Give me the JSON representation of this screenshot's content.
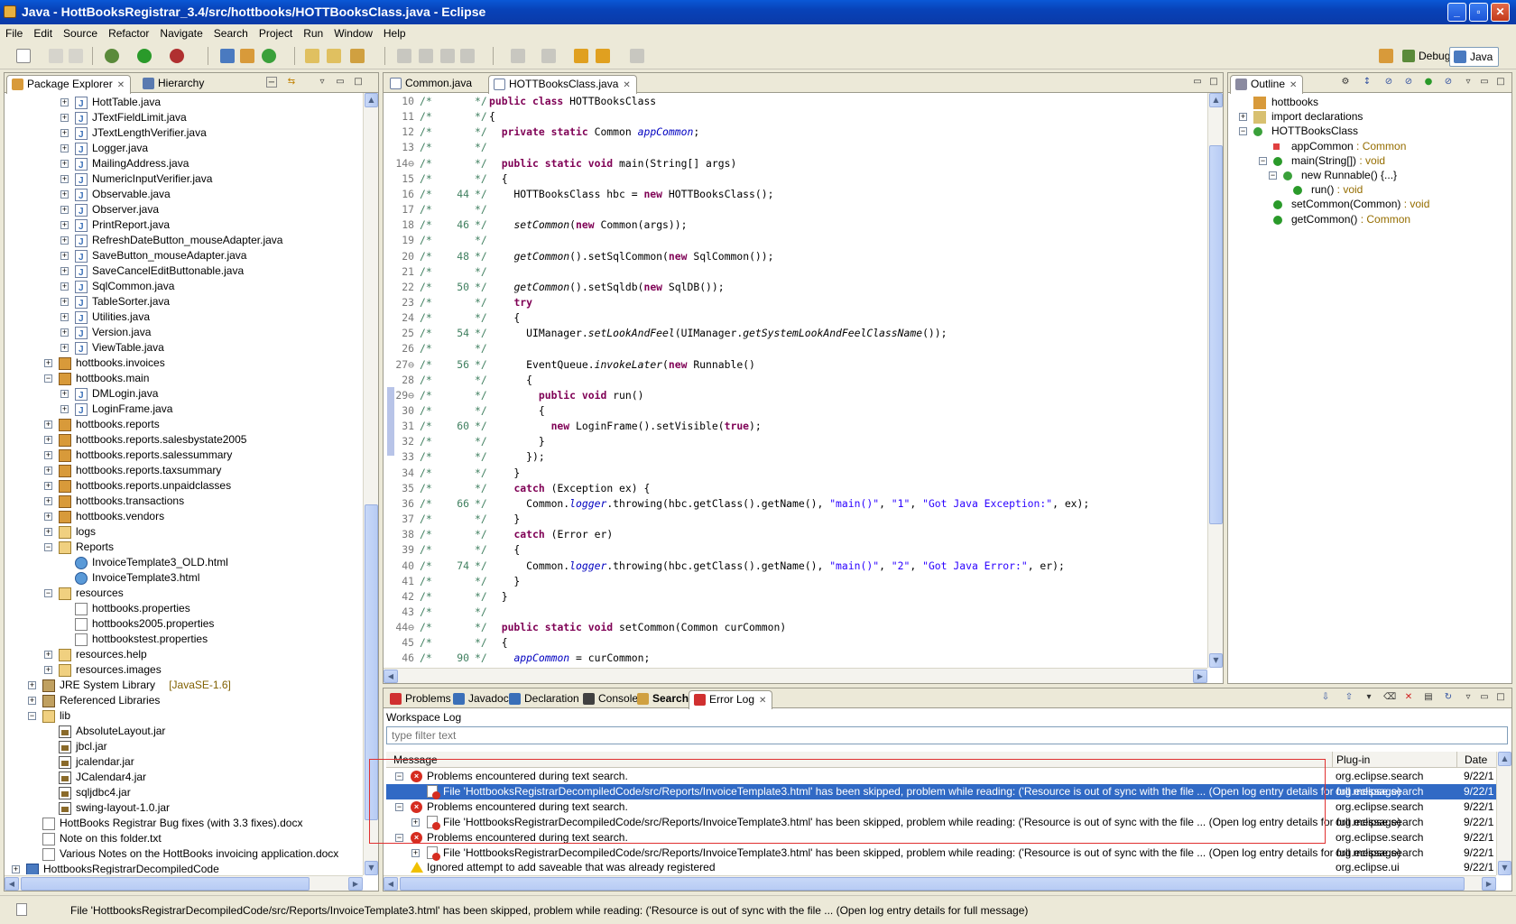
{
  "window": {
    "title": "Java - HottBooksRegistrar_3.4/src/hottbooks/HOTTBooksClass.java - Eclipse",
    "min": "_",
    "max": "▫",
    "close": "✕"
  },
  "menu": [
    "File",
    "Edit",
    "Source",
    "Refactor",
    "Navigate",
    "Search",
    "Project",
    "Run",
    "Window",
    "Help"
  ],
  "perspectives": {
    "debug": "Debug",
    "java": "Java"
  },
  "package_explorer": {
    "tabs": [
      "Package Explorer",
      "Hierarchy"
    ],
    "items": [
      {
        "label": "HottTable.java",
        "icon": "java",
        "indent": 3,
        "exp": "+"
      },
      {
        "label": "JTextFieldLimit.java",
        "icon": "java",
        "indent": 3,
        "exp": "+"
      },
      {
        "label": "JTextLengthVerifier.java",
        "icon": "java",
        "indent": 3,
        "exp": "+"
      },
      {
        "label": "Logger.java",
        "icon": "java",
        "indent": 3,
        "exp": "+"
      },
      {
        "label": "MailingAddress.java",
        "icon": "java",
        "indent": 3,
        "exp": "+"
      },
      {
        "label": "NumericInputVerifier.java",
        "icon": "java",
        "indent": 3,
        "exp": "+"
      },
      {
        "label": "Observable.java",
        "icon": "java",
        "indent": 3,
        "exp": "+"
      },
      {
        "label": "Observer.java",
        "icon": "java",
        "indent": 3,
        "exp": "+"
      },
      {
        "label": "PrintReport.java",
        "icon": "java",
        "indent": 3,
        "exp": "+"
      },
      {
        "label": "RefreshDateButton_mouseAdapter.java",
        "icon": "java",
        "indent": 3,
        "exp": "+"
      },
      {
        "label": "SaveButton_mouseAdapter.java",
        "icon": "java",
        "indent": 3,
        "exp": "+"
      },
      {
        "label": "SaveCancelEditButtonable.java",
        "icon": "java",
        "indent": 3,
        "exp": "+"
      },
      {
        "label": "SqlCommon.java",
        "icon": "java",
        "indent": 3,
        "exp": "+"
      },
      {
        "label": "TableSorter.java",
        "icon": "java",
        "indent": 3,
        "exp": "+"
      },
      {
        "label": "Utilities.java",
        "icon": "java",
        "indent": 3,
        "exp": "+"
      },
      {
        "label": "Version.java",
        "icon": "java",
        "indent": 3,
        "exp": "+"
      },
      {
        "label": "ViewTable.java",
        "icon": "java",
        "indent": 3,
        "exp": "+"
      },
      {
        "label": "hottbooks.invoices",
        "icon": "pkg",
        "indent": 2,
        "exp": "+"
      },
      {
        "label": "hottbooks.main",
        "icon": "pkg",
        "indent": 2,
        "exp": "-"
      },
      {
        "label": "DMLogin.java",
        "icon": "java",
        "indent": 3,
        "exp": "+"
      },
      {
        "label": "LoginFrame.java",
        "icon": "java",
        "indent": 3,
        "exp": "+"
      },
      {
        "label": "hottbooks.reports",
        "icon": "pkg",
        "indent": 2,
        "exp": "+"
      },
      {
        "label": "hottbooks.reports.salesbystate2005",
        "icon": "pkg",
        "indent": 2,
        "exp": "+"
      },
      {
        "label": "hottbooks.reports.salessummary",
        "icon": "pkg",
        "indent": 2,
        "exp": "+"
      },
      {
        "label": "hottbooks.reports.taxsummary",
        "icon": "pkg",
        "indent": 2,
        "exp": "+"
      },
      {
        "label": "hottbooks.reports.unpaidclasses",
        "icon": "pkg",
        "indent": 2,
        "exp": "+"
      },
      {
        "label": "hottbooks.transactions",
        "icon": "pkg",
        "indent": 2,
        "exp": "+"
      },
      {
        "label": "hottbooks.vendors",
        "icon": "pkg",
        "indent": 2,
        "exp": "+"
      },
      {
        "label": "logs",
        "icon": "folder",
        "indent": 2,
        "exp": "+"
      },
      {
        "label": "Reports",
        "icon": "folder",
        "indent": 2,
        "exp": "-"
      },
      {
        "label": "InvoiceTemplate3_OLD.html",
        "icon": "html",
        "indent": 3,
        "exp": ""
      },
      {
        "label": "InvoiceTemplate3.html",
        "icon": "html",
        "indent": 3,
        "exp": ""
      },
      {
        "label": "resources",
        "icon": "folder",
        "indent": 2,
        "exp": "-"
      },
      {
        "label": "hottbooks.properties",
        "icon": "file",
        "indent": 3,
        "exp": ""
      },
      {
        "label": "hottbooks2005.properties",
        "icon": "file",
        "indent": 3,
        "exp": ""
      },
      {
        "label": "hottbookstest.properties",
        "icon": "file",
        "indent": 3,
        "exp": ""
      },
      {
        "label": "resources.help",
        "icon": "folder",
        "indent": 2,
        "exp": "+"
      },
      {
        "label": "resources.images",
        "icon": "folder",
        "indent": 2,
        "exp": "+"
      },
      {
        "label": "JRE System Library",
        "suffix": "[JavaSE-1.6]",
        "icon": "lib",
        "indent": 1,
        "exp": "+"
      },
      {
        "label": "Referenced Libraries",
        "icon": "lib",
        "indent": 1,
        "exp": "+"
      },
      {
        "label": "lib",
        "icon": "folder",
        "indent": 1,
        "exp": "-"
      },
      {
        "label": "AbsoluteLayout.jar",
        "icon": "jar",
        "indent": 2,
        "exp": ""
      },
      {
        "label": "jbcl.jar",
        "icon": "jar",
        "indent": 2,
        "exp": ""
      },
      {
        "label": "jcalendar.jar",
        "icon": "jar",
        "indent": 2,
        "exp": ""
      },
      {
        "label": "JCalendar4.jar",
        "icon": "jar",
        "indent": 2,
        "exp": ""
      },
      {
        "label": "sqljdbc4.jar",
        "icon": "jar",
        "indent": 2,
        "exp": ""
      },
      {
        "label": "swing-layout-1.0.jar",
        "icon": "jar",
        "indent": 2,
        "exp": ""
      },
      {
        "label": "HottBooks Registrar Bug fixes (with 3.3 fixes).docx",
        "icon": "file",
        "indent": 1,
        "exp": ""
      },
      {
        "label": "Note on this folder.txt",
        "icon": "file",
        "indent": 1,
        "exp": ""
      },
      {
        "label": "Various Notes on the HottBooks invoicing application.docx",
        "icon": "file",
        "indent": 1,
        "exp": ""
      },
      {
        "label": "HottbooksRegistrarDecompiledCode",
        "icon": "proj",
        "indent": 0,
        "exp": "+"
      }
    ]
  },
  "editor": {
    "tabs": [
      "Common.java",
      "HOTTBooksClass.java"
    ],
    "lines": [
      {
        "n": "10",
        "c": "",
        "code": [
          [
            "kw",
            "public class "
          ],
          [
            "",
            "HOTTBooksClass"
          ]
        ]
      },
      {
        "n": "11",
        "c": "",
        "code": [
          [
            "",
            "{"
          ]
        ]
      },
      {
        "n": "12",
        "c": "",
        "code": [
          [
            "",
            "  "
          ],
          [
            "kw",
            "private static "
          ],
          [
            "",
            "Common "
          ],
          [
            "fi",
            "appCommon"
          ],
          [
            "",
            ";"
          ]
        ]
      },
      {
        "n": "13",
        "c": "",
        "code": []
      },
      {
        "n": "14⊖",
        "c": "",
        "code": [
          [
            "",
            "  "
          ],
          [
            "kw",
            "public static void "
          ],
          [
            "",
            "main(String[] args)"
          ]
        ]
      },
      {
        "n": "15",
        "c": "",
        "code": [
          [
            "",
            "  {"
          ]
        ]
      },
      {
        "n": "16",
        "c": "44",
        "code": [
          [
            "",
            "    HOTTBooksClass hbc = "
          ],
          [
            "kw",
            "new "
          ],
          [
            "",
            "HOTTBooksClass();"
          ]
        ]
      },
      {
        "n": "17",
        "c": "",
        "code": []
      },
      {
        "n": "18",
        "c": "46",
        "code": [
          [
            "",
            "    "
          ],
          [
            "it",
            "setCommon"
          ],
          [
            "",
            "("
          ],
          [
            "kw",
            "new "
          ],
          [
            "",
            "Common(args));"
          ]
        ]
      },
      {
        "n": "19",
        "c": "",
        "code": []
      },
      {
        "n": "20",
        "c": "48",
        "code": [
          [
            "",
            "    "
          ],
          [
            "it",
            "getCommon"
          ],
          [
            "",
            "().setSqlCommon("
          ],
          [
            "kw",
            "new "
          ],
          [
            "",
            "SqlCommon());"
          ]
        ]
      },
      {
        "n": "21",
        "c": "",
        "code": []
      },
      {
        "n": "22",
        "c": "50",
        "code": [
          [
            "",
            "    "
          ],
          [
            "it",
            "getCommon"
          ],
          [
            "",
            "().setSqldb("
          ],
          [
            "kw",
            "new "
          ],
          [
            "",
            "SqlDB());"
          ]
        ]
      },
      {
        "n": "23",
        "c": "",
        "code": [
          [
            "",
            "    "
          ],
          [
            "kw",
            "try"
          ]
        ]
      },
      {
        "n": "24",
        "c": "",
        "code": [
          [
            "",
            "    {"
          ]
        ]
      },
      {
        "n": "25",
        "c": "54",
        "code": [
          [
            "",
            "      UIManager."
          ],
          [
            "it",
            "setLookAndFeel"
          ],
          [
            "",
            "(UIManager."
          ],
          [
            "it",
            "getSystemLookAndFeelClassName"
          ],
          [
            "",
            "());"
          ]
        ]
      },
      {
        "n": "26",
        "c": "",
        "code": []
      },
      {
        "n": "27⊖",
        "c": "56",
        "code": [
          [
            "",
            "      EventQueue."
          ],
          [
            "it",
            "invokeLater"
          ],
          [
            "",
            "("
          ],
          [
            "kw",
            "new "
          ],
          [
            "",
            "Runnable()"
          ]
        ]
      },
      {
        "n": "28",
        "c": "",
        "code": [
          [
            "",
            "      {"
          ]
        ]
      },
      {
        "n": "29⊖",
        "c": "",
        "code": [
          [
            "",
            "        "
          ],
          [
            "kw",
            "public void "
          ],
          [
            "",
            "run()"
          ]
        ]
      },
      {
        "n": "30",
        "c": "",
        "code": [
          [
            "",
            "        {"
          ]
        ]
      },
      {
        "n": "31",
        "c": "60",
        "code": [
          [
            "",
            "          "
          ],
          [
            "kw",
            "new "
          ],
          [
            "",
            "LoginFrame().setVisible("
          ],
          [
            "kw",
            "true"
          ],
          [
            "",
            ");"
          ]
        ]
      },
      {
        "n": "32",
        "c": "",
        "code": [
          [
            "",
            "        }"
          ]
        ]
      },
      {
        "n": "33",
        "c": "",
        "code": [
          [
            "",
            "      });"
          ]
        ]
      },
      {
        "n": "34",
        "c": "",
        "code": [
          [
            "",
            "    }"
          ]
        ]
      },
      {
        "n": "35",
        "c": "",
        "code": [
          [
            "",
            "    "
          ],
          [
            "kw",
            "catch "
          ],
          [
            "",
            "(Exception ex) {"
          ]
        ]
      },
      {
        "n": "36",
        "c": "66",
        "code": [
          [
            "",
            "      Common."
          ],
          [
            "fi",
            "logger"
          ],
          [
            "",
            ".throwing(hbc.getClass().getName(), "
          ],
          [
            "st",
            "\"main()\""
          ],
          [
            "",
            ", "
          ],
          [
            "st",
            "\"1\""
          ],
          [
            "",
            ", "
          ],
          [
            "st",
            "\"Got Java Exception:\""
          ],
          [
            "",
            ", ex);"
          ]
        ]
      },
      {
        "n": "37",
        "c": "",
        "code": [
          [
            "",
            "    }"
          ]
        ]
      },
      {
        "n": "38",
        "c": "",
        "code": [
          [
            "",
            "    "
          ],
          [
            "kw",
            "catch "
          ],
          [
            "",
            "(Error er)"
          ]
        ]
      },
      {
        "n": "39",
        "c": "",
        "code": [
          [
            "",
            "    {"
          ]
        ]
      },
      {
        "n": "40",
        "c": "74",
        "code": [
          [
            "",
            "      Common."
          ],
          [
            "fi",
            "logger"
          ],
          [
            "",
            ".throwing(hbc.getClass().getName(), "
          ],
          [
            "st",
            "\"main()\""
          ],
          [
            "",
            ", "
          ],
          [
            "st",
            "\"2\""
          ],
          [
            "",
            ", "
          ],
          [
            "st",
            "\"Got Java Error:\""
          ],
          [
            "",
            ", er);"
          ]
        ]
      },
      {
        "n": "41",
        "c": "",
        "code": [
          [
            "",
            "    }"
          ]
        ]
      },
      {
        "n": "42",
        "c": "",
        "code": [
          [
            "",
            "  }"
          ]
        ]
      },
      {
        "n": "43",
        "c": "",
        "code": []
      },
      {
        "n": "44⊖",
        "c": "",
        "code": [
          [
            "",
            "  "
          ],
          [
            "kw",
            "public static void "
          ],
          [
            "",
            "setCommon(Common curCommon)"
          ]
        ]
      },
      {
        "n": "45",
        "c": "",
        "code": [
          [
            "",
            "  {"
          ]
        ]
      },
      {
        "n": "46",
        "c": "90",
        "code": [
          [
            "",
            "    "
          ],
          [
            "fi",
            "appCommon"
          ],
          [
            "",
            " = curCommon;"
          ]
        ]
      }
    ]
  },
  "outline": {
    "tab": "Outline",
    "items": [
      {
        "label": "hottbooks",
        "t": "",
        "indent": 0,
        "exp": "",
        "icon": "pkg"
      },
      {
        "label": "import declarations",
        "t": "",
        "indent": 0,
        "exp": "+",
        "icon": "imp"
      },
      {
        "label": "HOTTBooksClass",
        "t": "",
        "indent": 0,
        "exp": "-",
        "icon": "cls"
      },
      {
        "label": "appCommon",
        "t": " : Common",
        "indent": 2,
        "exp": "",
        "icon": "field"
      },
      {
        "label": "main(String[])",
        "t": " : void",
        "indent": 2,
        "exp": "-",
        "icon": "meth"
      },
      {
        "label": "new Runnable() {...}",
        "t": "",
        "indent": 3,
        "exp": "-",
        "icon": "cls"
      },
      {
        "label": "run()",
        "t": " : void",
        "indent": 4,
        "exp": "",
        "icon": "meth"
      },
      {
        "label": "setCommon(Common)",
        "t": " : void",
        "indent": 2,
        "exp": "",
        "icon": "meth"
      },
      {
        "label": "getCommon()",
        "t": " : Common",
        "indent": 2,
        "exp": "",
        "icon": "meth"
      }
    ]
  },
  "bottom": {
    "tabs": [
      "Problems",
      "Javadoc",
      "Declaration",
      "Console",
      "Search",
      "Error Log"
    ],
    "workspace_log": "Workspace Log",
    "filter_placeholder": "type filter text",
    "columns": {
      "message": "Message",
      "plugin": "Plug-in",
      "date": "Date"
    },
    "rows": [
      {
        "msg": "Problems encountered during text search.",
        "plugin": "org.eclipse.search",
        "date": "9/22/1",
        "kind": "err",
        "level": 0,
        "exp": "-",
        "sel": false
      },
      {
        "msg": "File 'HottbooksRegistrarDecompiledCode/src/Reports/InvoiceTemplate3.html' has been skipped, problem while reading: ('Resource is out of sync with the file ... (Open log entry details for full message)",
        "plugin": "org.eclipse.search",
        "date": "9/22/1",
        "kind": "doc",
        "level": 1,
        "exp": "",
        "sel": true
      },
      {
        "msg": "Problems encountered during text search.",
        "plugin": "org.eclipse.search",
        "date": "9/22/1",
        "kind": "err",
        "level": 0,
        "exp": "-",
        "sel": false
      },
      {
        "msg": "File 'HottbooksRegistrarDecompiledCode/src/Reports/InvoiceTemplate3.html' has been skipped, problem while reading: ('Resource is out of sync with the file ... (Open log entry details for full message)",
        "plugin": "org.eclipse.search",
        "date": "9/22/1",
        "kind": "doc",
        "level": 1,
        "exp": "+",
        "sel": false
      },
      {
        "msg": "Problems encountered during text search.",
        "plugin": "org.eclipse.search",
        "date": "9/22/1",
        "kind": "err",
        "level": 0,
        "exp": "-",
        "sel": false
      },
      {
        "msg": "File 'HottbooksRegistrarDecompiledCode/src/Reports/InvoiceTemplate3.html' has been skipped, problem while reading: ('Resource is out of sync with the file ... (Open log entry details for full message)",
        "plugin": "org.eclipse.search",
        "date": "9/22/1",
        "kind": "doc",
        "level": 1,
        "exp": "+",
        "sel": false
      },
      {
        "msg": "Ignored attempt to add saveable that was already registered",
        "plugin": "org.eclipse.ui",
        "date": "9/22/1",
        "kind": "warn",
        "level": 0,
        "exp": "",
        "sel": false
      }
    ]
  },
  "status": "File 'HottbooksRegistrarDecompiledCode/src/Reports/InvoiceTemplate3.html' has been skipped, problem while reading: ('Resource is out of sync with the file ... (Open log entry details for full message)"
}
